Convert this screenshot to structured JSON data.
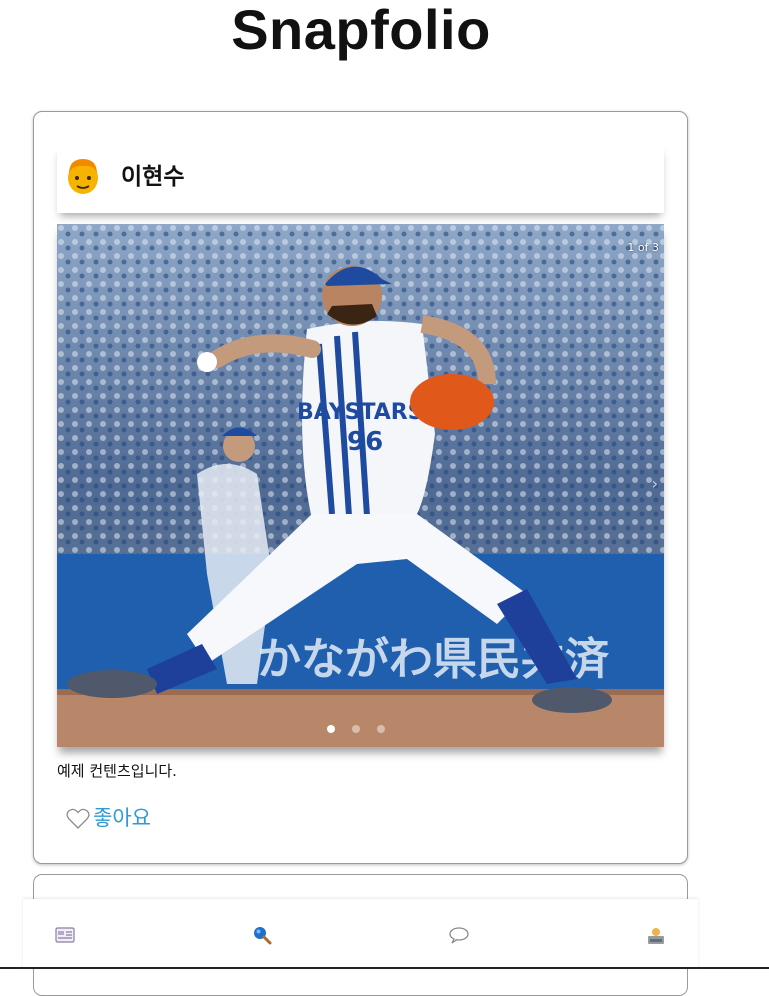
{
  "app": {
    "title": "Snapfolio"
  },
  "post": {
    "author": "이현수",
    "avatar_icon": "person-emoji-icon",
    "image_counter": "1 of 3",
    "image_count": 3,
    "active_image": 1,
    "caption": "예제 컨텐츠입니다.",
    "like_label": "좋아요",
    "like_icon": "heart-outline-icon",
    "photo_text": {
      "jersey_team": "BAYSTARS",
      "jersey_number": "96",
      "banner": "かながわ県民共済"
    }
  },
  "nav": {
    "items": [
      {
        "id": "feed",
        "icon": "newspaper-icon"
      },
      {
        "id": "search",
        "icon": "search-icon"
      },
      {
        "id": "messages",
        "icon": "chat-bubble-icon"
      },
      {
        "id": "profile",
        "icon": "profile-icon"
      }
    ]
  },
  "colors": {
    "accent": "#2d9ad6",
    "border": "#9a9a9a"
  }
}
